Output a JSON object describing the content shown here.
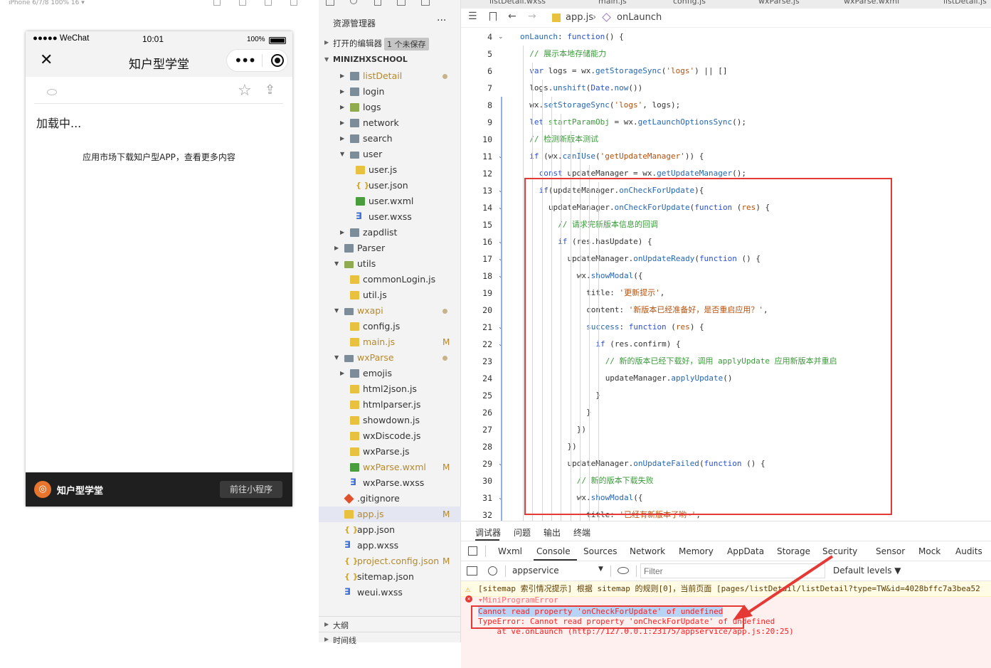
{
  "simulator": {
    "top_label": "iPhone 6/7/8 100% 16 ▾",
    "status": {
      "carrier": "●●●●● WeChat",
      "time": "10:01",
      "battery": "100%"
    },
    "nav": {
      "title": "知户型学堂"
    },
    "content": {
      "loading": "加载中...",
      "promo": "应用市场下载知户型APP，查看更多内容"
    },
    "bottom": {
      "name": "知户型学堂",
      "button": "前往小程序"
    }
  },
  "explorer": {
    "title": "资源管理器",
    "more": "···",
    "open_editors": "打开的编辑器",
    "unsaved": "1 个未保存",
    "project": "MINIZHXSCHOOL",
    "tree": [
      {
        "label": "listDetail",
        "type": "folder",
        "level": 2,
        "collapsed": true,
        "status": "dot",
        "color": "#b5892b"
      },
      {
        "label": "login",
        "type": "folder",
        "level": 2,
        "collapsed": true
      },
      {
        "label": "logs",
        "type": "folder-special",
        "level": 2,
        "collapsed": true
      },
      {
        "label": "network",
        "type": "folder",
        "level": 2,
        "collapsed": true
      },
      {
        "label": "search",
        "type": "folder",
        "level": 2,
        "collapsed": true
      },
      {
        "label": "user",
        "type": "folder-open",
        "level": 2,
        "collapsed": false
      },
      {
        "label": "user.js",
        "type": "js",
        "level": 3
      },
      {
        "label": "user.json",
        "type": "json",
        "level": 3
      },
      {
        "label": "user.wxml",
        "type": "wxml",
        "level": 3
      },
      {
        "label": "user.wxss",
        "type": "wxss",
        "level": 3
      },
      {
        "label": "zapdlist",
        "type": "folder",
        "level": 2,
        "collapsed": true
      },
      {
        "label": "Parser",
        "type": "folder",
        "level": 1,
        "collapsed": true
      },
      {
        "label": "utils",
        "type": "folder-special-open",
        "level": 1,
        "collapsed": false
      },
      {
        "label": "commonLogin.js",
        "type": "js",
        "level": 2
      },
      {
        "label": "util.js",
        "type": "js",
        "level": 2
      },
      {
        "label": "wxapi",
        "type": "folder-open",
        "level": 1,
        "collapsed": false,
        "status": "dot",
        "color": "#b5892b"
      },
      {
        "label": "config.js",
        "type": "js",
        "level": 2
      },
      {
        "label": "main.js",
        "type": "js",
        "level": 2,
        "status": "M",
        "color": "#b5892b"
      },
      {
        "label": "wxParse",
        "type": "folder-open",
        "level": 1,
        "collapsed": false,
        "status": "dot",
        "color": "#b5892b"
      },
      {
        "label": "emojis",
        "type": "folder",
        "level": 2,
        "collapsed": true
      },
      {
        "label": "html2json.js",
        "type": "js",
        "level": 2
      },
      {
        "label": "htmlparser.js",
        "type": "js",
        "level": 2
      },
      {
        "label": "showdown.js",
        "type": "js",
        "level": 2
      },
      {
        "label": "wxDiscode.js",
        "type": "js",
        "level": 2
      },
      {
        "label": "wxParse.js",
        "type": "js",
        "level": 2
      },
      {
        "label": "wxParse.wxml",
        "type": "wxml",
        "level": 2,
        "status": "M",
        "color": "#b5892b"
      },
      {
        "label": "wxParse.wxss",
        "type": "wxss",
        "level": 2
      },
      {
        "label": ".gitignore",
        "type": "git",
        "level": 1
      },
      {
        "label": "app.js",
        "type": "js",
        "level": 1,
        "status": "M",
        "color": "#b5892b",
        "selected": true
      },
      {
        "label": "app.json",
        "type": "json",
        "level": 1
      },
      {
        "label": "app.wxss",
        "type": "wxss",
        "level": 1
      },
      {
        "label": "project.config.json",
        "type": "json",
        "level": 1,
        "status": "M",
        "color": "#b5892b"
      },
      {
        "label": "sitemap.json",
        "type": "json",
        "level": 1
      },
      {
        "label": "weui.wxss",
        "type": "wxss",
        "level": 1
      }
    ],
    "outline": "大纲",
    "timeline": "时间线"
  },
  "editor": {
    "tabs": [
      "listDetail.wxss",
      "main.js",
      "config.js",
      "wxParse.js",
      "wxParse.wxml",
      "listDetail.js"
    ],
    "breadcrumb": {
      "file": "app.js",
      "symbol": "onLaunch"
    },
    "lines": [
      {
        "n": "4",
        "fold": true,
        "indent": 0,
        "tokens": [
          [
            "fn",
            "onLaunch"
          ],
          [
            "",
            ": "
          ],
          [
            "kw",
            "function"
          ],
          [
            "",
            "() {"
          ]
        ]
      },
      {
        "n": "5",
        "indent": 1,
        "tokens": [
          [
            "cm",
            "// 展示本地存储能力"
          ]
        ]
      },
      {
        "n": "6",
        "indent": 1,
        "tokens": [
          [
            "kw",
            "var"
          ],
          [
            "",
            " logs = wx."
          ],
          [
            "fn",
            "getStorageSync"
          ],
          [
            "",
            "("
          ],
          [
            "st",
            "'logs'"
          ],
          [
            "",
            ") || []"
          ]
        ]
      },
      {
        "n": "7",
        "indent": 1,
        "tokens": [
          [
            "",
            "logs."
          ],
          [
            "fn",
            "unshift"
          ],
          [
            "",
            "("
          ],
          [
            "kw",
            "Date"
          ],
          [
            "",
            "."
          ],
          [
            "fn",
            "now"
          ],
          [
            "",
            "())"
          ]
        ]
      },
      {
        "n": "8",
        "indent": 1,
        "tokens": [
          [
            "",
            "wx."
          ],
          [
            "fn",
            "setStorageSync"
          ],
          [
            "",
            "("
          ],
          [
            "st",
            "'logs'"
          ],
          [
            "",
            ", logs);"
          ]
        ]
      },
      {
        "n": "9",
        "indent": 1,
        "tokens": [
          [
            "kw",
            "let"
          ],
          [
            "",
            " "
          ],
          [
            "cm",
            "startParamObj"
          ],
          [
            "",
            " = wx."
          ],
          [
            "fn",
            "getLaunchOptionsSync"
          ],
          [
            "",
            "();"
          ]
        ]
      },
      {
        "n": "10",
        "indent": 1,
        "tokens": [
          [
            "cm",
            "// 检测新版本测试"
          ]
        ]
      },
      {
        "n": "11",
        "fold": true,
        "indent": 1,
        "tokens": [
          [
            "kw",
            "if"
          ],
          [
            "",
            " (wx."
          ],
          [
            "fn",
            "canIUse"
          ],
          [
            "",
            "("
          ],
          [
            "st",
            "'getUpdateManager'"
          ],
          [
            "",
            ")) {"
          ]
        ]
      },
      {
        "n": "12",
        "indent": 2,
        "tokens": [
          [
            "kw",
            "const"
          ],
          [
            "",
            " updateManager = wx."
          ],
          [
            "fn",
            "getUpdateManager"
          ],
          [
            "",
            "();"
          ]
        ]
      },
      {
        "n": "13",
        "fold": true,
        "indent": 2,
        "tokens": [
          [
            "kw",
            "if"
          ],
          [
            "",
            "(updateManager."
          ],
          [
            "fn",
            "onCheckForUpdate"
          ],
          [
            "",
            "){"
          ]
        ]
      },
      {
        "n": "14",
        "fold": true,
        "indent": 3,
        "tokens": [
          [
            "",
            "updateManager."
          ],
          [
            "fn",
            "onCheckForUpdate"
          ],
          [
            "",
            "("
          ],
          [
            "kw",
            "function"
          ],
          [
            "",
            " ("
          ],
          [
            "st",
            "res"
          ],
          [
            "",
            ") {"
          ]
        ]
      },
      {
        "n": "15",
        "indent": 4,
        "tokens": [
          [
            "cm",
            "// 请求完新版本信息的回调"
          ]
        ]
      },
      {
        "n": "16",
        "fold": true,
        "indent": 4,
        "tokens": [
          [
            "kw",
            "if"
          ],
          [
            "",
            " (res.hasUpdate) {"
          ]
        ]
      },
      {
        "n": "17",
        "fold": true,
        "indent": 5,
        "tokens": [
          [
            "",
            "updateManager."
          ],
          [
            "fn",
            "onUpdateReady"
          ],
          [
            "",
            "("
          ],
          [
            "kw",
            "function"
          ],
          [
            "",
            " () {"
          ]
        ]
      },
      {
        "n": "18",
        "fold": true,
        "indent": 6,
        "tokens": [
          [
            "",
            "wx."
          ],
          [
            "fn",
            "showModal"
          ],
          [
            "",
            "({"
          ]
        ]
      },
      {
        "n": "19",
        "indent": 7,
        "tokens": [
          [
            "",
            "title: "
          ],
          [
            "st",
            "'更新提示'"
          ],
          [
            "",
            ","
          ]
        ]
      },
      {
        "n": "20",
        "indent": 7,
        "tokens": [
          [
            "",
            "content: "
          ],
          [
            "st",
            "'新版本已经准备好，是否重启应用？'"
          ],
          [
            "",
            ","
          ]
        ]
      },
      {
        "n": "21",
        "fold": true,
        "indent": 7,
        "tokens": [
          [
            "fn",
            "success"
          ],
          [
            "",
            ": "
          ],
          [
            "kw",
            "function"
          ],
          [
            "",
            " ("
          ],
          [
            "st",
            "res"
          ],
          [
            "",
            ") {"
          ]
        ]
      },
      {
        "n": "22",
        "fold": true,
        "indent": 8,
        "tokens": [
          [
            "kw",
            "if"
          ],
          [
            "",
            " (res.confirm) {"
          ]
        ]
      },
      {
        "n": "23",
        "indent": 9,
        "tokens": [
          [
            "cm",
            "// 新的版本已经下载好，调用 applyUpdate 应用新版本并重启"
          ]
        ]
      },
      {
        "n": "24",
        "indent": 9,
        "tokens": [
          [
            "",
            "updateManager."
          ],
          [
            "fn",
            "applyUpdate"
          ],
          [
            "",
            "()"
          ]
        ]
      },
      {
        "n": "25",
        "indent": 8,
        "tokens": [
          [
            "",
            "}"
          ]
        ]
      },
      {
        "n": "26",
        "indent": 7,
        "tokens": [
          [
            "",
            "}"
          ]
        ]
      },
      {
        "n": "27",
        "indent": 6,
        "tokens": [
          [
            "",
            "})"
          ]
        ]
      },
      {
        "n": "28",
        "indent": 5,
        "tokens": [
          [
            "",
            "})"
          ]
        ]
      },
      {
        "n": "29",
        "fold": true,
        "indent": 5,
        "tokens": [
          [
            "",
            "updateManager."
          ],
          [
            "fn",
            "onUpdateFailed"
          ],
          [
            "",
            "("
          ],
          [
            "kw",
            "function"
          ],
          [
            "",
            " () {"
          ]
        ]
      },
      {
        "n": "30",
        "indent": 6,
        "tokens": [
          [
            "cm",
            "// 新的版本下载失败"
          ]
        ]
      },
      {
        "n": "31",
        "fold": true,
        "indent": 6,
        "tokens": [
          [
            "",
            "wx."
          ],
          [
            "fn",
            "showModal"
          ],
          [
            "",
            "({"
          ]
        ]
      },
      {
        "n": "32",
        "indent": 7,
        "tokens": [
          [
            "",
            "title: "
          ],
          [
            "st",
            "'已经有新版本了哟~'"
          ],
          [
            "",
            ","
          ]
        ]
      }
    ]
  },
  "panel": {
    "tabs": [
      "调试器",
      "问题",
      "输出",
      "终端"
    ],
    "devtools_tabs": [
      "Wxml",
      "Console",
      "Sources",
      "Network",
      "Memory",
      "AppData",
      "Storage",
      "Security",
      "Sensor",
      "Mock",
      "Audits"
    ],
    "active_devtools_tab": "Console",
    "context": "appservice",
    "filter_placeholder": "Filter",
    "levels": "Default levels ▼",
    "warning": "[sitemap 索引情况提示] 根据 sitemap 的规则[0]，当前页面 [pages/listDetail/listDetail?type=TW&id=4028bffc7a3bea52",
    "error_header": "▾MiniProgramError",
    "error_lines": [
      "Cannot read property 'onCheckForUpdate' of undefined",
      "TypeError: Cannot read property 'onCheckForUpdate' of undefined",
      "    at ve.onLaunch (http://127.0.0.1:23175/appservice/app.js:20:25)"
    ]
  },
  "colors": {
    "highlight_red": "#e53935",
    "error_text": "#fe2020",
    "accent_blue": "#2a4fd6"
  }
}
